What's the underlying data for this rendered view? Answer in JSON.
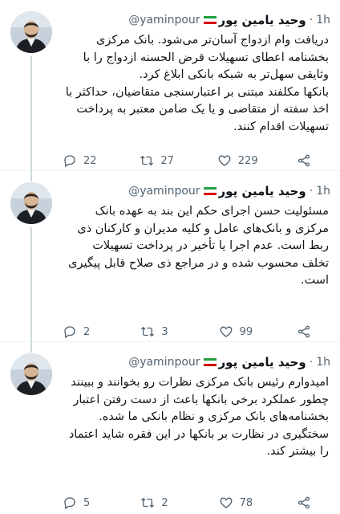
{
  "colors": {
    "text_primary": "#0f1419",
    "text_secondary": "#536471",
    "divider": "#eff3f4",
    "flag_green": "#239f40",
    "flag_white": "#ffffff",
    "flag_red": "#da0000"
  },
  "tweets": [
    {
      "author": {
        "name": "وحید یامین پور",
        "handle": "@yaminpour",
        "flag_icon": "iran-flag-icon"
      },
      "dot": "·",
      "time": "1h",
      "text": "دریافت وام ازدواج آسان‌تر می‌شود. بانک مرکزی بخشنامه اعطای تسهیلات قرض الحسنه ازدواج را با وثایقی سهل‌تر به شبکه بانکی ابلاغ کرد.\nبانکها مکلفند مبتنی بر اعتبارسنجی متقاضیان، حداکثر با اخذ سفته از متقاضی و یا یک ضامن معتبر به پرداخت تسهیلات اقدام کنند.",
      "counts": {
        "replies": "22",
        "retweets": "27",
        "likes": "229"
      }
    },
    {
      "author": {
        "name": "وحید یامین پور",
        "handle": "@yaminpour",
        "flag_icon": "iran-flag-icon"
      },
      "dot": "·",
      "time": "1h",
      "text": "مسئولیت حسن اجرای حکم این بند به عهده بانک مرکزی و بانک‌های عامل و کلیه مدیران و کارکنان ذی ربط است. عدم اجرا یا تأخیر در پرداخت تسهیلات تخلف محسوب شده و در مراجع ذی صلاح قابل پیگیری است.",
      "counts": {
        "replies": "2",
        "retweets": "3",
        "likes": "99"
      }
    },
    {
      "author": {
        "name": "وحید یامین پور",
        "handle": "@yaminpour",
        "flag_icon": "iran-flag-icon"
      },
      "dot": "·",
      "time": "1h",
      "text": "امیدوارم رئیس بانک مرکزی نظرات رو بخوانند و ببینند چطور عملکرد برخی بانکها باعث از دست رفتن اعتبار بخشنامه‌های بانک مرکزی و نظام بانکی ما شده.\nسختگیری در نظارت بر بانکها در این فقره شاید اعتماد را بیشتر کند.",
      "counts": {
        "replies": "5",
        "retweets": "2",
        "likes": "78"
      }
    }
  ]
}
